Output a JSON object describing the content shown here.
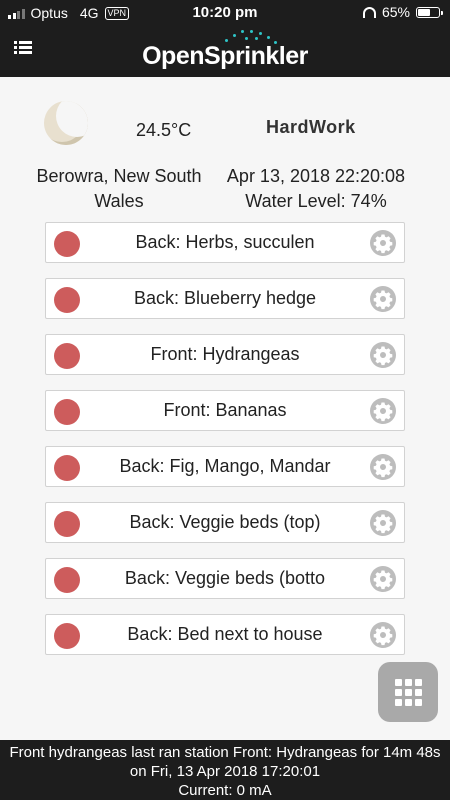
{
  "status_bar": {
    "carrier": "Optus",
    "network": "4G",
    "vpn": "VPN",
    "time": "10:20 pm",
    "battery": "65%",
    "battery_level": 0.65
  },
  "header": {
    "logo_text": "OpenSprinkler",
    "menu_icon": "menu-icon"
  },
  "info": {
    "weather_icon": "moon-icon",
    "temperature": "24.5°C",
    "device_name": "HardWork",
    "location": "Berowra, New South Wales",
    "datetime": "Apr 13, 2018 22:20:08",
    "water_level": "Water Level: 74%"
  },
  "stations": [
    {
      "name": "Back: Herbs, succulen",
      "status_color": "#cd5c5c"
    },
    {
      "name": "Back: Blueberry hedge",
      "status_color": "#cd5c5c"
    },
    {
      "name": "Front: Hydrangeas",
      "status_color": "#cd5c5c"
    },
    {
      "name": "Front: Bananas",
      "status_color": "#cd5c5c"
    },
    {
      "name": "Back: Fig, Mango, Mandar",
      "status_color": "#cd5c5c"
    },
    {
      "name": "Back: Veggie beds (top)",
      "status_color": "#cd5c5c"
    },
    {
      "name": "Back: Veggie beds (botto",
      "status_color": "#cd5c5c"
    },
    {
      "name": "Back: Bed next to house",
      "status_color": "#cd5c5c"
    }
  ],
  "fab": {
    "icon": "keypad-icon"
  },
  "footer": {
    "last_run": "Front hydrangeas last ran station Front: Hydrangeas for 14m 48s on Fri, 13 Apr 2018 17:20:01",
    "current": "Current: 0 mA"
  },
  "colors": {
    "header_bg": "#1d1d1d",
    "station_off": "#cd5c5c",
    "accent_dots": "#2ec4c6"
  }
}
